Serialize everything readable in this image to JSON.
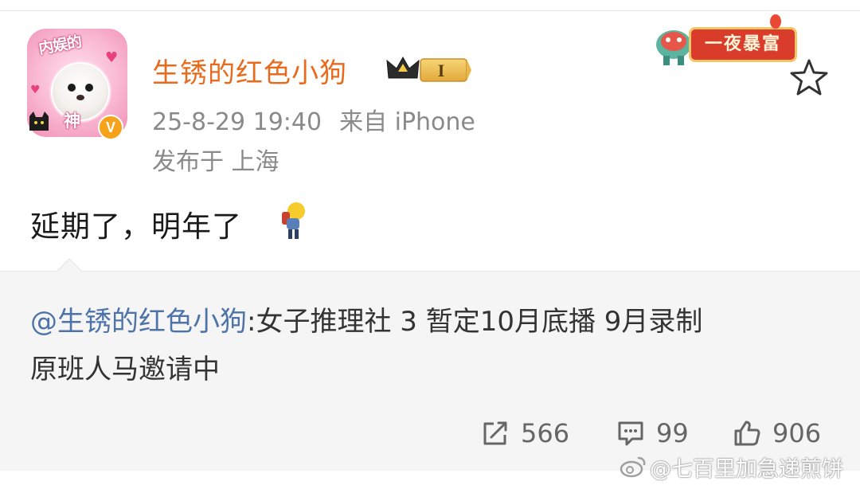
{
  "post": {
    "author": {
      "name": "生锈的红色小狗",
      "avatar_top_text": "内娱的",
      "avatar_bottom_text": "神",
      "verified_badge": "V",
      "vip_level": "I"
    },
    "date": "25-8-29 19:40",
    "source": "来自 iPhone",
    "location": "发布于 上海",
    "decoration_text": "一夜暴富",
    "text": "延期了，明年了",
    "emoji": "bow-emoji",
    "repost": {
      "mention": "@生锈的红色小狗",
      "line1_rest": ":女子推理社 3 暂定10月底播 9月录制",
      "line2": "原班人马邀请中"
    },
    "stats": {
      "reposts": "566",
      "comments": "99",
      "likes": "906"
    }
  },
  "watermark": {
    "text": "@七百里加急递煎饼"
  },
  "colors": {
    "username": "#e86a1c",
    "mention": "#4e73a8",
    "meta": "#8a8a8a",
    "repost_bg": "#f5f5f5"
  }
}
